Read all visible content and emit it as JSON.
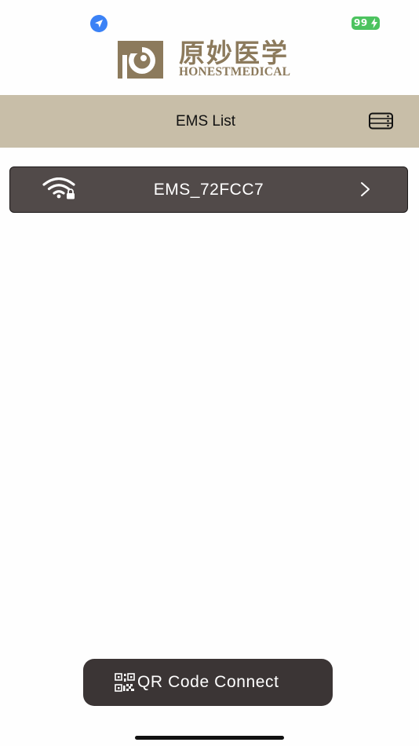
{
  "status_bar": {
    "battery_level": "99",
    "icons": [
      "location-arrow-icon",
      "charging-bolt-icon"
    ],
    "battery_color": "#4cc35f",
    "location_color": "#3b82f6"
  },
  "brand": {
    "name_cn": "原妙医学",
    "name_en": "HONESTMEDICAL",
    "color": "#8c7a5c"
  },
  "nav": {
    "title": "EMS List",
    "background": "#c8bea8",
    "right_icon": "router-icon"
  },
  "devices": [
    {
      "name": "EMS_72FCC7",
      "icons": [
        "wifi-lock-icon",
        "chevron-right-icon"
      ]
    }
  ],
  "actions": {
    "qr_connect_label": "QR Code Connect",
    "qr_icon": "qr-scan-icon"
  }
}
